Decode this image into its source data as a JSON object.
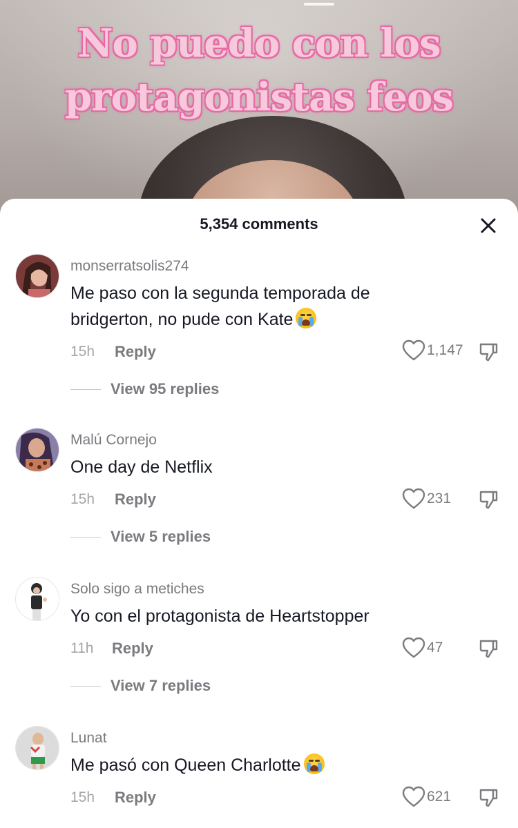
{
  "video": {
    "caption_line1": "No puedo con los",
    "caption_line2": "protagonistas feos"
  },
  "sheet": {
    "comments_count": "5,354 comments"
  },
  "comments": [
    {
      "username": "monserratsolis274",
      "text": "Me paso con la segunda temporada de bridgerton, no pude con Kate",
      "emoji": "loudly-crying-face",
      "time": "15h",
      "reply_label": "Reply",
      "likes": "1,147",
      "view_replies": "View 95 replies"
    },
    {
      "username": "Malú Cornejo",
      "text": "One day de Netflix",
      "time": "15h",
      "reply_label": "Reply",
      "likes": "231",
      "view_replies": "View 5 replies"
    },
    {
      "username": "Solo sigo a metiches",
      "text": "Yo con el protagonista de Heartstopper",
      "time": "11h",
      "reply_label": "Reply",
      "likes": "47",
      "view_replies": "View 7 replies"
    },
    {
      "username": "Lunat",
      "text": "Me pasó con Queen Charlotte",
      "emoji": "loudly-crying-face",
      "time": "15h",
      "reply_label": "Reply",
      "likes": "621"
    }
  ],
  "colors": {
    "caption_fill": "#f7c9dc",
    "caption_outline": "#e86aa4",
    "text_primary": "#161823",
    "text_secondary": "#7a7a7f"
  }
}
